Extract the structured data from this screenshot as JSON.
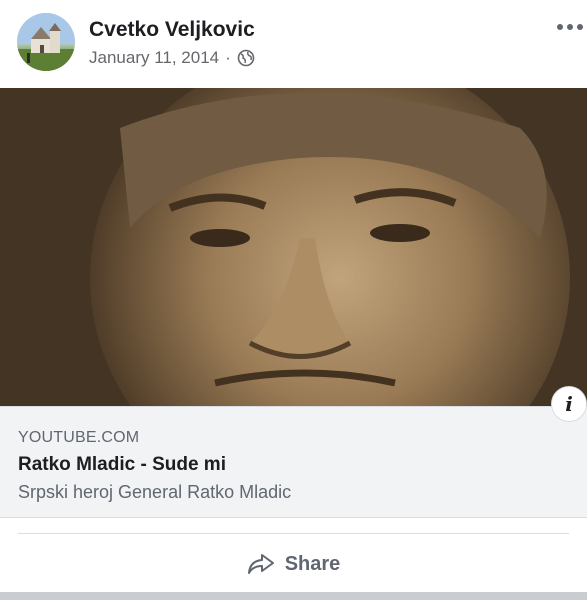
{
  "post": {
    "author": "Cvetko Veljkovic",
    "date": "January 11, 2014",
    "separator": "·",
    "privacy_icon": "globe-icon",
    "more_icon": "more-options-icon"
  },
  "link_preview": {
    "domain": "YOUTUBE.COM",
    "title": "Ratko Mladic - Sude mi",
    "description": "Srpski heroj General Ratko Mladic",
    "info_label": "i"
  },
  "actions": {
    "share_label": "Share",
    "share_icon": "share-arrow-icon"
  },
  "colors": {
    "text_primary": "#1c1e21",
    "text_secondary": "#65676b",
    "preview_bg": "#f2f3f5",
    "image_tone": "#8c7050"
  }
}
